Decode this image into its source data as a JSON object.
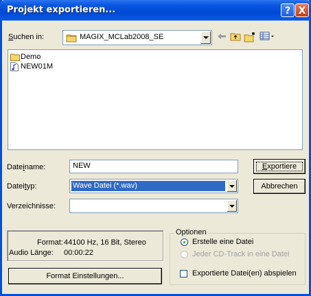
{
  "window": {
    "title": "Projekt exportieren...",
    "help_label": "?",
    "close_label": "X"
  },
  "lookin": {
    "label_pre": "",
    "label_u": "S",
    "label_post": "uchen in:",
    "value": "MAGIX_MCLab2008_SE"
  },
  "files": [
    {
      "name": "Demo",
      "type": "folder"
    },
    {
      "name": "NEW01M",
      "type": "audio-file"
    }
  ],
  "filename": {
    "label_pre": "Date",
    "label_u": "i",
    "label_post": "name:",
    "value": "NEW"
  },
  "filetype": {
    "label_pre": "Datei",
    "label_u": "t",
    "label_post": "yp:",
    "value": "Wave Datei (*.wav)"
  },
  "directories": {
    "label": "Verzeichnisse:",
    "value": ""
  },
  "buttons": {
    "export_pre": "",
    "export_u": "E",
    "export_post": "xportiere",
    "cancel": "Abbrechen",
    "format_settings": "Format Einstellungen..."
  },
  "info": {
    "format_label": "Format:",
    "format_value": "44100 Hz, 16 Bit, Stereo",
    "length_label": "Audio Länge:",
    "length_value": "00:00:22"
  },
  "options": {
    "title": "Optionen",
    "create_one_file": "Erstelle eine Datei",
    "each_track": "Jeder CD-Track in eine Datei",
    "play_exported": "Exportierte Datei(en) abspielen",
    "create_one_checked": true,
    "play_checked": false
  },
  "colors": {
    "titlebar": "#0a56e0",
    "selection": "#316ac5",
    "window_bg": "#ece9d8"
  }
}
